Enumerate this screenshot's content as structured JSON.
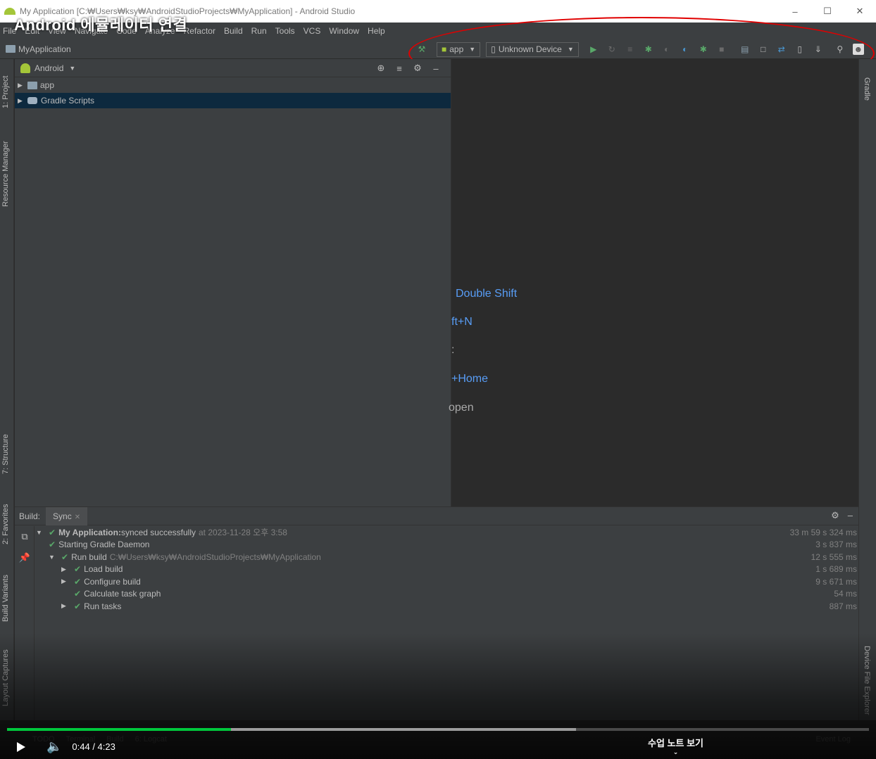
{
  "window": {
    "title": "My Application [C:₩Users₩ksy₩AndroidStudioProjects₩MyApplication] - Android Studio",
    "minimize": "–",
    "maximize": "☐",
    "close": "✕"
  },
  "video_caption": "Android 에뮬레이터 연결",
  "menu": [
    "File",
    "Edit",
    "View",
    "Navigate",
    "Code",
    "Analyze",
    "Refactor",
    "Build",
    "Run",
    "Tools",
    "VCS",
    "Window",
    "Help"
  ],
  "navbar": {
    "project_name": "MyApplication",
    "run_config": "app",
    "device": "Unknown Device"
  },
  "left_tabs": [
    "1: Project",
    "Resource Manager",
    "7: Structure",
    "2: Favorites",
    "Build Variants",
    "Layout Captures"
  ],
  "right_tabs": [
    "Gradle",
    "Device File Explorer"
  ],
  "project_panel": {
    "view_mode": "Android",
    "tree": [
      {
        "label": "app",
        "selected": false
      },
      {
        "label": "Gradle Scripts",
        "selected": true
      }
    ]
  },
  "editor_hints": [
    {
      "text": "Double Shift",
      "color": "blue"
    },
    {
      "text": "ft+N",
      "color": "blue"
    },
    {
      "text": ":",
      "color": "gray"
    },
    {
      "text": "+Home",
      "color": "blue"
    },
    {
      "text": "open",
      "color": "gray"
    }
  ],
  "build_panel": {
    "label": "Build:",
    "tab": "Sync",
    "rows": [
      {
        "indent": 0,
        "arrow": "▼",
        "check": true,
        "title": "My Application:",
        "text": " synced successfully",
        "dim": "at 2023-11-28 오후 3:58",
        "time": "33 m 59 s 324 ms",
        "bold": true
      },
      {
        "indent": 1,
        "arrow": "",
        "check": true,
        "title": "",
        "text": "Starting Gradle Daemon",
        "dim": "",
        "time": "3 s 837 ms",
        "bold": false
      },
      {
        "indent": 1,
        "arrow": "▼",
        "check": true,
        "title": "",
        "text": "Run build",
        "dim": "C:₩Users₩ksy₩AndroidStudioProjects₩MyApplication",
        "time": "12 s 555 ms",
        "bold": false
      },
      {
        "indent": 2,
        "arrow": "▶",
        "check": true,
        "title": "",
        "text": "Load build",
        "dim": "",
        "time": "1 s 689 ms",
        "bold": false
      },
      {
        "indent": 2,
        "arrow": "▶",
        "check": true,
        "title": "",
        "text": "Configure build",
        "dim": "",
        "time": "9 s 671 ms",
        "bold": false
      },
      {
        "indent": 2,
        "arrow": "",
        "check": true,
        "title": "",
        "text": "Calculate task graph",
        "dim": "",
        "time": "54 ms",
        "bold": false
      },
      {
        "indent": 2,
        "arrow": "▶",
        "check": true,
        "title": "",
        "text": "Run tasks",
        "dim": "",
        "time": "887 ms",
        "bold": false
      }
    ]
  },
  "statusbar": {
    "items": [
      "TODO",
      "Terminal",
      "Build",
      "6: Logcat"
    ],
    "event_log": "Event Log"
  },
  "video": {
    "time": "0:44 / 4:23",
    "played_fraction": 0.26,
    "buffered_fraction": 0.66,
    "note_button": "수업 노트 보기"
  }
}
